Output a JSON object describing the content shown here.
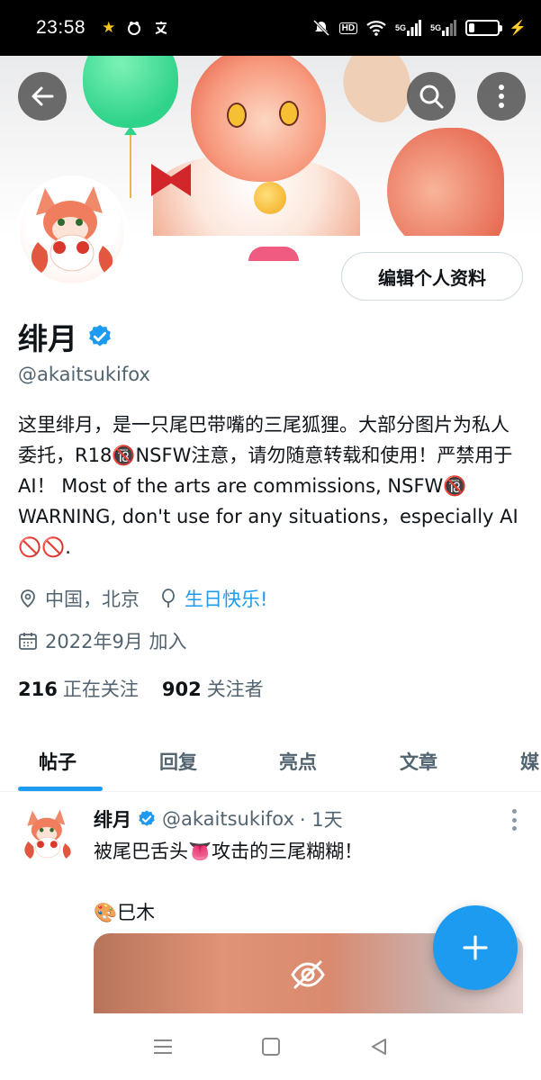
{
  "status_bar": {
    "time": "23:58",
    "battery_level": 0.2,
    "signal_labels": [
      "5G",
      "5G"
    ],
    "hd_label": "HD"
  },
  "header": {
    "back_icon": "arrow-left-icon",
    "search_icon": "search-icon",
    "more_icon": "more-vertical-icon"
  },
  "profile": {
    "edit_button_label": "编辑个人资料",
    "name": "绯月",
    "handle": "@akaitsukifox",
    "bio": "这里绯月，是一只尾巴带嘴的三尾狐狸。大部分图片为私人委托，R18🔞NSFW注意，请勿随意转载和使用！严禁用于AI！  Most of the arts are commissions, NSFW🔞 WARNING, don't use for any situations，especially AI 🚫🚫.",
    "location": "中国，北京",
    "birthday": "生日快乐!",
    "joined": "2022年9月 加入",
    "following_count": "216",
    "following_label": "正在关注",
    "followers_count": "902",
    "followers_label": "关注者"
  },
  "tabs": [
    {
      "label": "帖子",
      "active": true
    },
    {
      "label": "回复",
      "active": false
    },
    {
      "label": "亮点",
      "active": false
    },
    {
      "label": "文章",
      "active": false
    },
    {
      "label": "媒",
      "active": false
    }
  ],
  "post": {
    "name": "绯月",
    "handle": "@akaitsukifox",
    "time": "· 1天",
    "text": "被尾巴舌头👅攻击的三尾糊糊！\n\n🎨巳木"
  },
  "colors": {
    "accent": "#1d9bf0",
    "text_secondary": "#536471"
  }
}
